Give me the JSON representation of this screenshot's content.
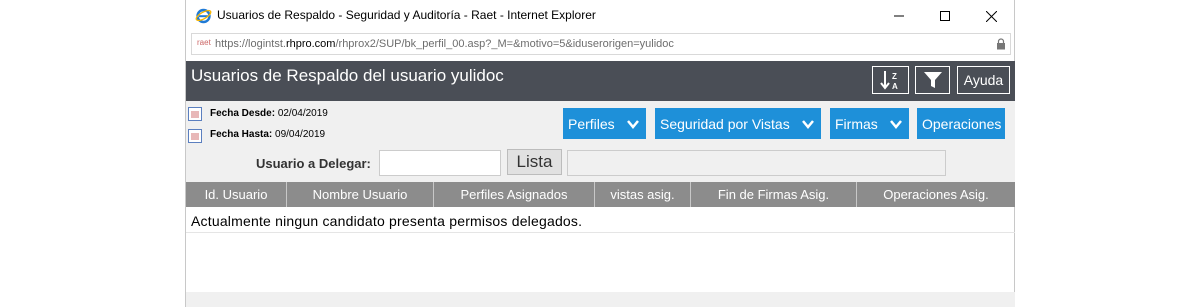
{
  "window": {
    "title": "Usuarios de Respaldo - Seguridad y Auditoría - Raet - Internet Explorer",
    "address_prefix": "https://logintst.",
    "address_domain": "rhpro.com",
    "address_path": "/rhprox2/SUP/bk_perfil_00.asp?_M=&motivo=5&iduserorigen=yulidoc",
    "address_icon_text": "raet"
  },
  "header": {
    "title": "Usuarios de Respaldo del usuario yulidoc",
    "help_label": "Ayuda"
  },
  "filters": {
    "fecha_desde_label": "Fecha Desde:",
    "fecha_desde_value": "02/04/2019",
    "fecha_hasta_label": "Fecha Hasta:",
    "fecha_hasta_value": "09/04/2019",
    "menus": [
      "Perfiles",
      "Seguridad por Vistas",
      "Firmas",
      "Operaciones"
    ],
    "delegate_label": "Usuario a Delegar:",
    "delegate_value": "",
    "lista_label": "Lista",
    "lista_value": ""
  },
  "table": {
    "columns": [
      "Id. Usuario",
      "Nombre Usuario",
      "Perfiles Asignados",
      "vistas asig.",
      "Fin de Firmas Asig.",
      "Operaciones Asig."
    ],
    "empty_message": "Actualmente ningun candidato presenta permisos delegados."
  },
  "colors": {
    "header_bg": "#4a4e56",
    "accent": "#1e90d9",
    "table_header": "#8c8c8c"
  }
}
